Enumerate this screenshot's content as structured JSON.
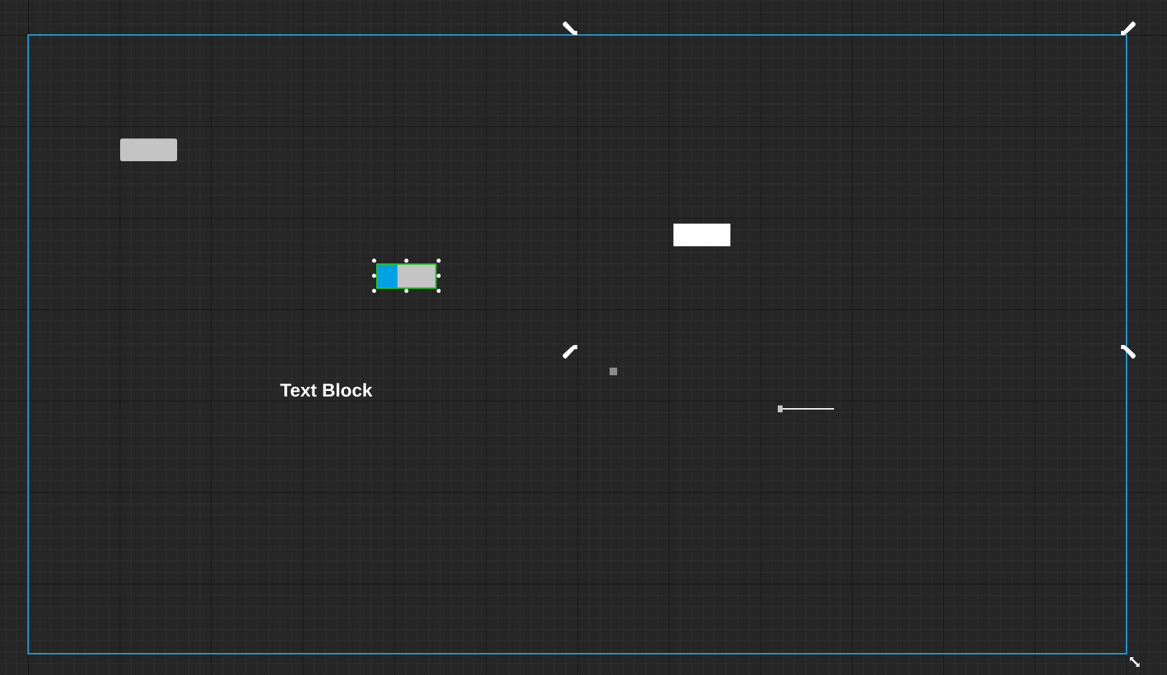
{
  "designer": {
    "accent_color": "#1aa3e0",
    "selection_color": "#1ec81e"
  },
  "widgets": {
    "text_block": {
      "text": "Text Block",
      "color": "#ffffff"
    },
    "button": {
      "color": "#c4c4c4"
    },
    "text_box": {
      "color": "#ffffff"
    },
    "progress_bar": {
      "percent": 35,
      "fill_color": "#00a0e4",
      "background_color": "#c4c4c4"
    },
    "check_box": {
      "color": "#8c8c8c"
    },
    "slider": {
      "value": 0.0
    }
  },
  "icons": {
    "anchor": "anchor-petal-icon",
    "resize": "resize-diagonal-icon"
  }
}
